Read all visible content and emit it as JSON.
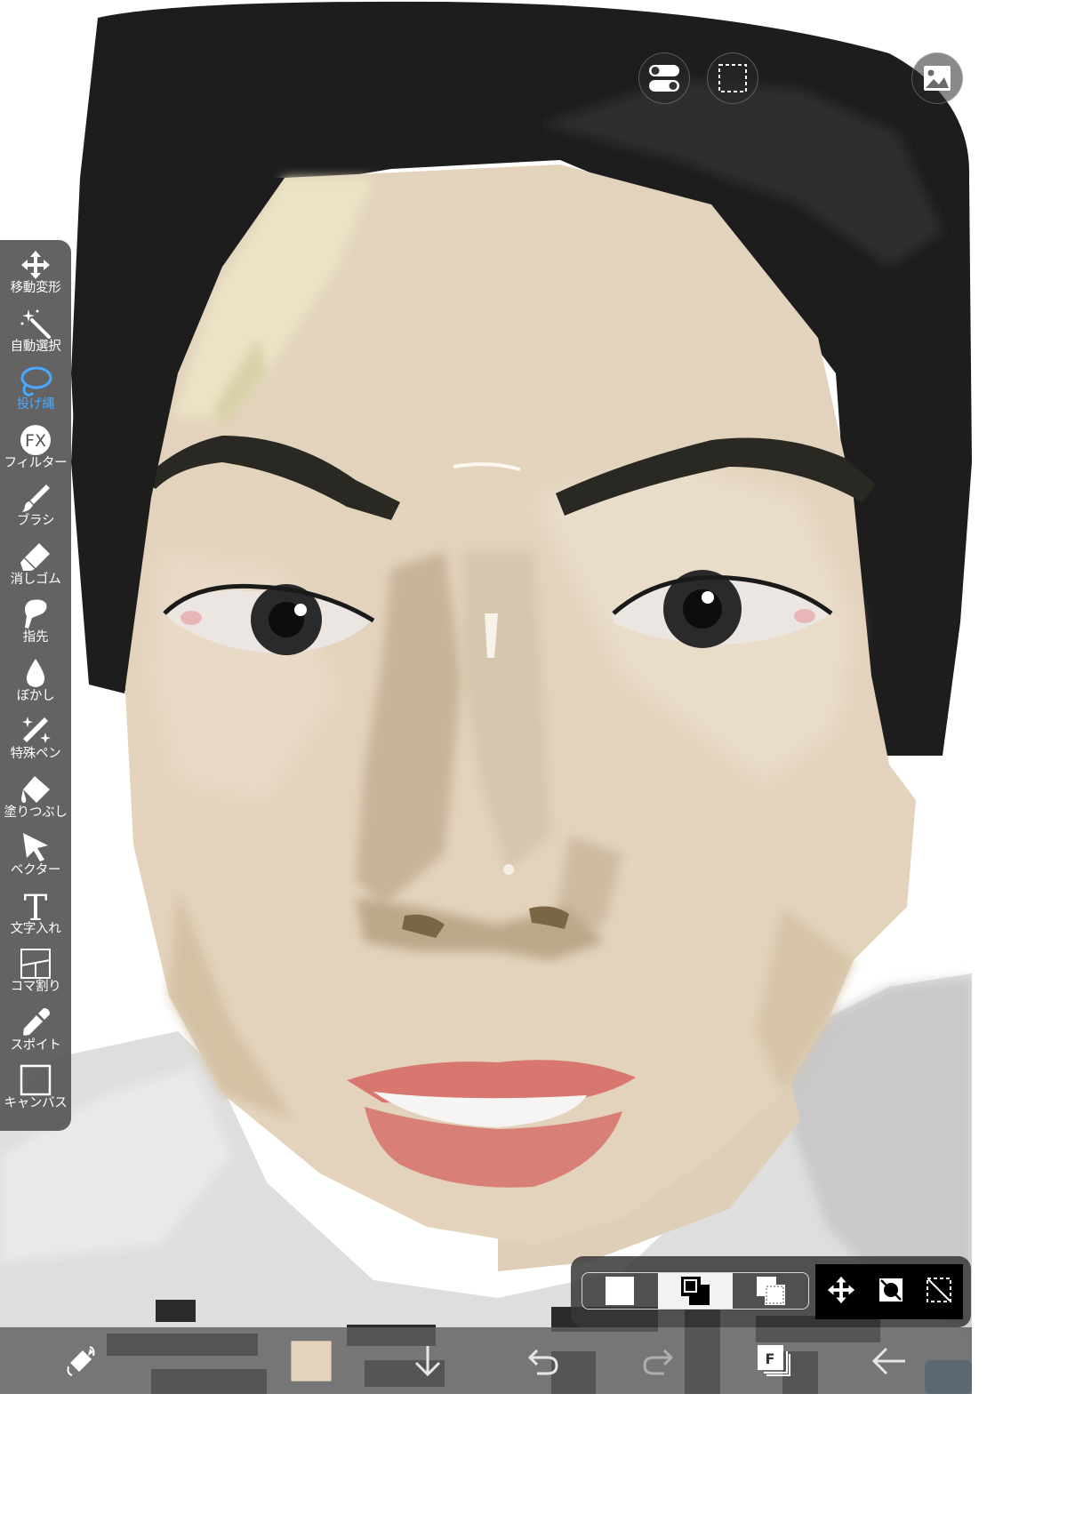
{
  "canvas": {
    "artwork": "digital portrait painting",
    "colors": {
      "hair": "#1e1e1e",
      "skin": "#e3d3bd",
      "skin_shadow": "#c4b095",
      "lips": "#d77a71",
      "shirt": "#d9d9d9",
      "background": "#ffffff"
    }
  },
  "top_buttons": [
    {
      "name": "toggle",
      "icon": "toggle-icon"
    },
    {
      "name": "selection",
      "icon": "dashed-rect-icon"
    },
    {
      "name": "reference",
      "icon": "image-icon"
    }
  ],
  "toolbar": {
    "active_tool": "lasso",
    "tools": [
      {
        "id": "move",
        "label": "移動変形",
        "icon": "move-icon"
      },
      {
        "id": "magic-wand",
        "label": "自動選択",
        "icon": "magic-wand-icon"
      },
      {
        "id": "lasso",
        "label": "投げ縄",
        "icon": "lasso-icon"
      },
      {
        "id": "filter",
        "label": "フィルター",
        "icon": "fx-icon",
        "icon_text": "FX"
      },
      {
        "id": "brush",
        "label": "ブラシ",
        "icon": "brush-icon"
      },
      {
        "id": "eraser",
        "label": "消しゴム",
        "icon": "eraser-icon"
      },
      {
        "id": "finger",
        "label": "指先",
        "icon": "finger-icon"
      },
      {
        "id": "blur",
        "label": "ぼかし",
        "icon": "drop-icon"
      },
      {
        "id": "special-pen",
        "label": "特殊ペン",
        "icon": "sparkle-pen-icon"
      },
      {
        "id": "fill",
        "label": "塗りつぶし",
        "icon": "bucket-icon"
      },
      {
        "id": "vector",
        "label": "ベクター",
        "icon": "cursor-arrow-icon"
      },
      {
        "id": "text",
        "label": "文字入れ",
        "icon": "text-icon",
        "icon_text": "T"
      },
      {
        "id": "frame",
        "label": "コマ割り",
        "icon": "frame-divider-icon"
      },
      {
        "id": "eyedropper",
        "label": "スポイト",
        "icon": "eyedropper-icon"
      },
      {
        "id": "canvas",
        "label": "キャンバス",
        "icon": "canvas-icon"
      }
    ]
  },
  "selection_panel": {
    "modes": [
      "new",
      "add",
      "subtract"
    ],
    "active_mode": "add",
    "actions": [
      "move",
      "invert",
      "clear"
    ]
  },
  "bottom_bar": {
    "current_color": "#e3d3bd",
    "layer_icon_text": "F",
    "items": [
      "quick-menu",
      "color",
      "download",
      "undo",
      "redo",
      "layers",
      "back"
    ]
  },
  "accent_color": "#4aa8ff"
}
